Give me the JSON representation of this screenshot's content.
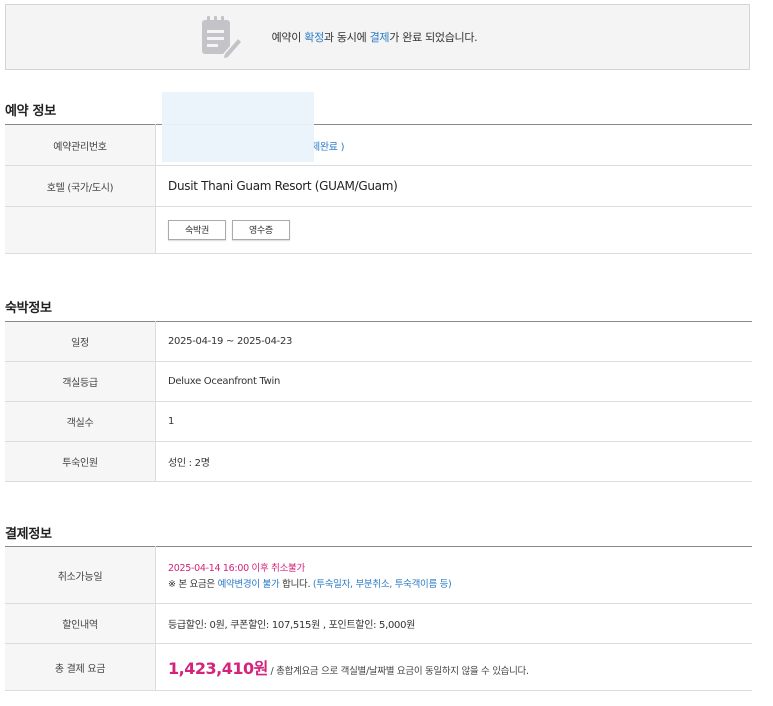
{
  "banner": {
    "icon": "document-edit-icon",
    "msg_part1": "예약이 ",
    "msg_hl1": "확정",
    "msg_part2": "과 동시에 ",
    "msg_hl2": "결제",
    "msg_part3": "가 완료 되었습니다."
  },
  "reservation": {
    "title": "예약 정보",
    "rows": {
      "booking_no_label": "예약관리번호",
      "booking_no_status": "제완료 )",
      "hotel_label": "호텔 (국가/도시)",
      "hotel_value": "Dusit Thani Guam Resort (GUAM/Guam)",
      "voucher_button": "숙박권",
      "receipt_button": "영수증"
    }
  },
  "stay": {
    "title": "숙박정보",
    "rows": [
      {
        "label": "일정",
        "value": "2025-04-19 ~ 2025-04-23"
      },
      {
        "label": "객실등급",
        "value": "Deluxe Oceanfront Twin"
      },
      {
        "label": "객실수",
        "value": "1"
      },
      {
        "label": "투숙인원",
        "value": "성인 : 2명"
      }
    ]
  },
  "payment": {
    "title": "결제정보",
    "cancel_label": "취소가능일",
    "cancel_line1": "2025-04-14 16:00 이후 취소불가",
    "cancel_note_prefix": "※ 본 요금은 ",
    "cancel_note_hl": "예약변경이 불가",
    "cancel_note_mid": " 합니다. ",
    "cancel_note_tail": "(투숙일자, 부분취소, 투숙객이름 등)",
    "discount_label": "할인내역",
    "discount_value": "등급할인: 0원, 쿠폰할인: 107,515원 , 포인트할인: 5,000원",
    "total_label": "총 결제 요금",
    "total_value": "1,423,410원",
    "total_note": " / 총합계요금 으로 객실별/날짜별 요금이 동일하지 않을 수 있습니다."
  },
  "colors": {
    "accent_blue": "#2b7bc7",
    "accent_pink": "#d4237a"
  }
}
